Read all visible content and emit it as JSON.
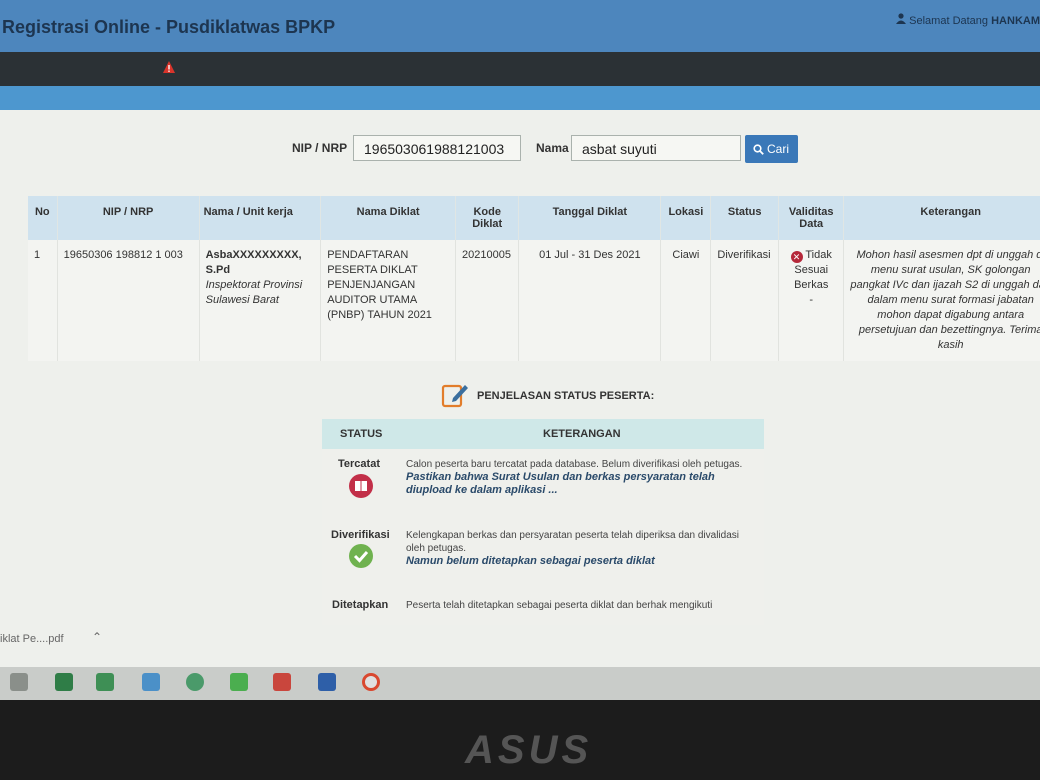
{
  "header": {
    "app_title": "Registrasi Online - Pusdiklatwas BPKP",
    "welcome_prefix": "Selamat Datang",
    "welcome_user": "HANKAM"
  },
  "search": {
    "nip_label": "NIP / NRP",
    "nip_value": "196503061988121003",
    "name_label": "Nama",
    "name_value": "asbat suyuti",
    "button_label": "Cari"
  },
  "table": {
    "headers": [
      "No",
      "NIP / NRP",
      "Nama / Unit kerja",
      "Nama Diklat",
      "Kode Diklat",
      "Tanggal Diklat",
      "Lokasi",
      "Status",
      "Validitas Data",
      "Keterangan"
    ],
    "row": {
      "no": "1",
      "nip": "19650306 198812 1 003",
      "name": "AsbaXXXXXXXXX, S.Pd",
      "unit": "Inspektorat Provinsi Sulawesi Barat",
      "diklat": "PENDAFTARAN PESERTA DIKLAT PENJENJANGAN AUDITOR UTAMA (PNBP) TAHUN 2021",
      "kode": "20210005",
      "tanggal": "01 Jul - 31 Des 2021",
      "lokasi": "Ciawi",
      "status": "Diverifikasi",
      "validitas": "Tidak Sesuai Berkas",
      "validitas_extra": "-",
      "keterangan": "Mohon hasil asesmen dpt di unggah di menu surat usulan, SK golongan pangkat IVc dan ijazah S2 di unggah dan dalam menu surat formasi jabatan mohon dapat digabung antara persetujuan dan bezettingnya. Terima kasih"
    }
  },
  "legend": {
    "title": "PENJELASAN STATUS PESERTA:",
    "col_status": "STATUS",
    "col_keterangan": "KETERANGAN",
    "items": [
      {
        "status": "Tercatat",
        "desc": "Calon peserta baru tercatat pada database. Belum diverifikasi oleh petugas.",
        "note": "Pastikan bahwa Surat Usulan dan berkas persyaratan telah diupload ke dalam aplikasi ..."
      },
      {
        "status": "Diverifikasi",
        "desc": "Kelengkapan berkas dan persyaratan peserta telah diperiksa dan divalidasi oleh petugas.",
        "note": "Namun belum ditetapkan sebagai peserta diklat"
      },
      {
        "status": "Ditetapkan",
        "desc": "Peserta telah ditetapkan sebagai peserta diklat dan berhak mengikuti",
        "note": ""
      }
    ]
  },
  "download": {
    "file": "iklat Pe....pdf"
  },
  "bezel": {
    "brand": "ASUS"
  },
  "colors": {
    "topbar": "#4d86bd",
    "darkbar": "#2b3135",
    "button": "#3a78b8",
    "table_header": "#cfe2ee",
    "legend_header": "#cfe8e8"
  }
}
